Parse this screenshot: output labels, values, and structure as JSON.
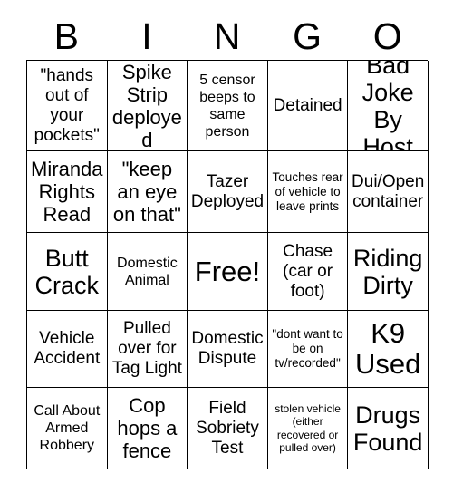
{
  "card": {
    "title": "BINGO",
    "header_letters": [
      "B",
      "I",
      "N",
      "G",
      "O"
    ],
    "free_space_index": 12,
    "colors": {
      "background": "#ffffff",
      "text": "#000000",
      "border": "#000000"
    },
    "grid": {
      "rows": 5,
      "columns": 5
    },
    "cells": [
      {
        "text": "\"hands out of your pockets\"",
        "size": "fs-md"
      },
      {
        "text": "Spike Strip deployed",
        "size": "fs-lg"
      },
      {
        "text": "5 censor beeps to same person",
        "size": "fs-sm"
      },
      {
        "text": "Detained",
        "size": "fs-md"
      },
      {
        "text": "Bad Joke By Host",
        "size": "fs-xl"
      },
      {
        "text": "Miranda Rights Read",
        "size": "fs-lg"
      },
      {
        "text": "\"keep an eye on that\"",
        "size": "fs-lg"
      },
      {
        "text": "Tazer Deployed",
        "size": "fs-md"
      },
      {
        "text": "Touches rear of vehicle to leave prints",
        "size": "fs-xs"
      },
      {
        "text": "Dui/Open container",
        "size": "fs-md"
      },
      {
        "text": "Butt Crack",
        "size": "fs-xl"
      },
      {
        "text": "Domestic Animal",
        "size": "fs-sm"
      },
      {
        "text": "Free!",
        "size": "fs-xxl"
      },
      {
        "text": "Chase (car or foot)",
        "size": "fs-md"
      },
      {
        "text": "Riding Dirty",
        "size": "fs-xl"
      },
      {
        "text": "Vehicle Accident",
        "size": "fs-md"
      },
      {
        "text": "Pulled over for Tag Light",
        "size": "fs-md"
      },
      {
        "text": "Domestic Dispute",
        "size": "fs-md"
      },
      {
        "text": "\"dont want to be on tv/recorded\"",
        "size": "fs-xs"
      },
      {
        "text": "K9 Used",
        "size": "fs-xxl"
      },
      {
        "text": "Call About Armed Robbery",
        "size": "fs-sm"
      },
      {
        "text": "Cop hops a fence",
        "size": "fs-lg"
      },
      {
        "text": "Field Sobriety Test",
        "size": "fs-md"
      },
      {
        "text": "stolen vehicle (either recovered or pulled over)",
        "size": "fs-xxs"
      },
      {
        "text": "Drugs Found",
        "size": "fs-xl"
      }
    ]
  }
}
